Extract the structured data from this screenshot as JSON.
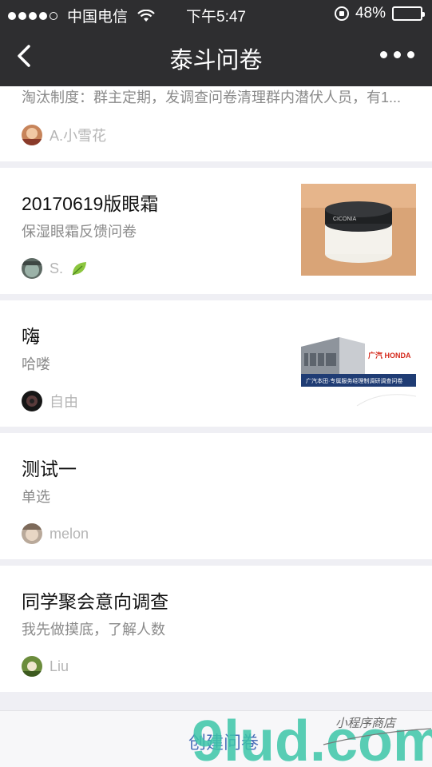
{
  "status_bar": {
    "carrier": "中国电信",
    "time": "下午5:47",
    "battery": "48%",
    "battery_level": 0.48
  },
  "nav": {
    "title": "泰斗问卷"
  },
  "items": [
    {
      "title": "",
      "desc": "淘汰制度：群主定期，发调查问卷清理群内潜伏人员，有1...",
      "author": "A.小雪花"
    },
    {
      "title": "20170619版眼霜",
      "desc": "保湿眼霜反馈问卷",
      "author": "S."
    },
    {
      "title": "嗨",
      "desc": "哈喽",
      "author": "自由"
    },
    {
      "title": "测试一",
      "desc": "单选",
      "author": "melon"
    },
    {
      "title": "同学聚会意向调查",
      "desc": "我先做摸底，了解人数",
      "author": "Liu"
    }
  ],
  "thumb_text": {
    "jar_brand": "CICONIA",
    "honda_brand": "广汽 HONDA",
    "honda_caption": "广汽本田·专属服务经理制调研调查问卷"
  },
  "bottom": {
    "create_label": "创建问卷"
  },
  "watermark": {
    "text": "9lud.com",
    "sub": "小程序商店"
  }
}
